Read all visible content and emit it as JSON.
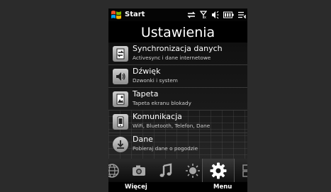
{
  "statusbar": {
    "start_label": "Start",
    "icons": [
      "windows-flag-icon",
      "sync-arrows-icon",
      "signal-icon",
      "speaker-icon",
      "battery-icon",
      "menu-lines-icon"
    ]
  },
  "page": {
    "title": "Ustawienia"
  },
  "list": {
    "items": [
      {
        "title": "Synchronizacja danych",
        "subtitle": "Activesync i dane internetowe",
        "icon": "sync-icon"
      },
      {
        "title": "Dźwięk",
        "subtitle": "Dzwonki i system",
        "icon": "speaker-icon"
      },
      {
        "title": "Tapeta",
        "subtitle": "Tapeta ekranu blokady",
        "icon": "wallpaper-icon"
      },
      {
        "title": "Komunikacja",
        "subtitle": "WiFi, Bluetooth, Telefon, Dane",
        "icon": "phone-icon"
      },
      {
        "title": "Dane",
        "subtitle": "Pobieraj dane o pogodzie",
        "icon": "download-icon"
      }
    ]
  },
  "tabs": [
    "internet-globe-icon",
    "camera-icon",
    "music-note-icon",
    "weather-sun-icon",
    "settings-gear-icon",
    "apps-icon"
  ],
  "active_tab": "settings-gear-icon",
  "softkeys": {
    "left": "Więcej",
    "right": "Menu"
  }
}
